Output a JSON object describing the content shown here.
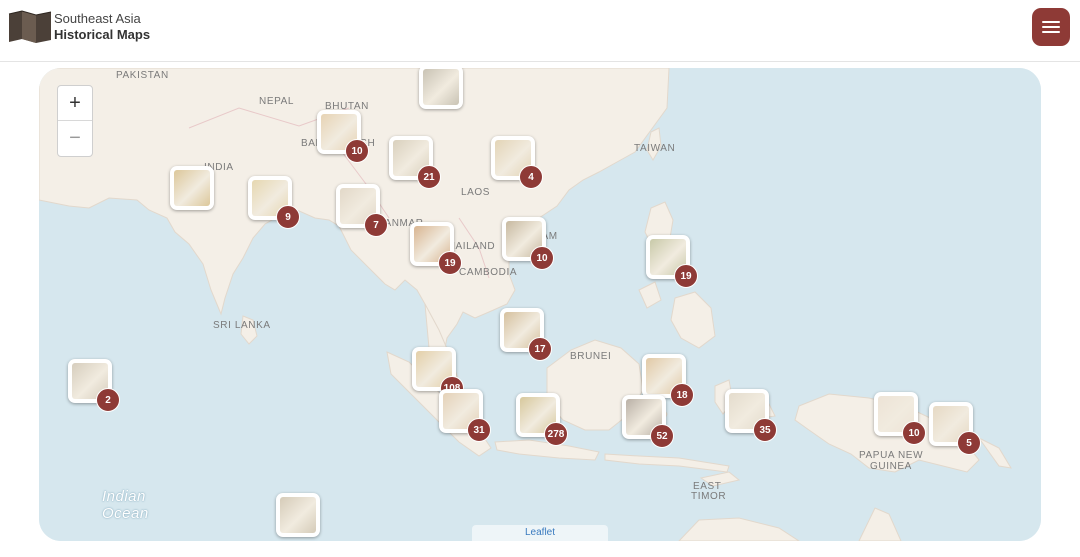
{
  "brand": {
    "line1": "Southeast Asia",
    "line2": "Historical Maps",
    "logo_icon": "folded-map-icon"
  },
  "header": {
    "menu_icon": "hamburger-menu-icon",
    "accent": "#8e3a36"
  },
  "map": {
    "zoom_in": "+",
    "zoom_out": "−",
    "attribution": "Leaflet",
    "labels": [
      "PAKISTAN",
      "NEPAL",
      "BHUTAN",
      "BANGLADESH",
      "INDIA",
      "LAOS",
      "MYANMAR",
      "THAILAND",
      "VIETNAM",
      "CAMBODIA",
      "TAIWAN",
      "SRI LANKA",
      "BRUNEI",
      "EAST",
      "TIMOR",
      "PAPUA NEW",
      "GUINEA"
    ],
    "ocean_label": [
      "Indian",
      "Ocean"
    ],
    "clusters": [
      {
        "count": "",
        "thumb": "#c9c3b4",
        "place": "china-north"
      },
      {
        "count": "10",
        "thumb": "#e7d3b4",
        "place": "bhutan"
      },
      {
        "count": "21",
        "thumb": "#d9d0bd",
        "place": "yunnan"
      },
      {
        "count": "4",
        "thumb": "#e3d4b6",
        "place": "south-china"
      },
      {
        "count": "",
        "thumb": "#dcc79a",
        "place": "india"
      },
      {
        "count": "9",
        "thumb": "#e6d7b0",
        "place": "bengal"
      },
      {
        "count": "7",
        "thumb": "#e2d8c8",
        "place": "myanmar"
      },
      {
        "count": "19",
        "thumb": "#d8b490",
        "place": "thailand"
      },
      {
        "count": "10",
        "thumb": "#c7b9a0",
        "place": "vietnam"
      },
      {
        "count": "19",
        "thumb": "#c8c9a8",
        "place": "philippines"
      },
      {
        "count": "17",
        "thumb": "#d5c09e",
        "place": "south-china-sea"
      },
      {
        "count": "2",
        "thumb": "#d6cdbd",
        "place": "maldives"
      },
      {
        "count": "108",
        "thumb": "#e3cfa8",
        "place": "malaya"
      },
      {
        "count": "18",
        "thumb": "#e1c9a6",
        "place": "borneo-east"
      },
      {
        "count": "31",
        "thumb": "#e4d1b8",
        "place": "sumatra"
      },
      {
        "count": "278",
        "thumb": "#d7c89c",
        "place": "java"
      },
      {
        "count": "52",
        "thumb": "#b9b0a6",
        "place": "sulawesi"
      },
      {
        "count": "35",
        "thumb": "#e4dccd",
        "place": "maluku"
      },
      {
        "count": "10",
        "thumb": "#ede3d6",
        "place": "papua-west"
      },
      {
        "count": "5",
        "thumb": "#e6d9c4",
        "place": "png"
      },
      {
        "count": "",
        "thumb": "#d5cbb8",
        "place": "indian-ocean-south"
      }
    ]
  }
}
